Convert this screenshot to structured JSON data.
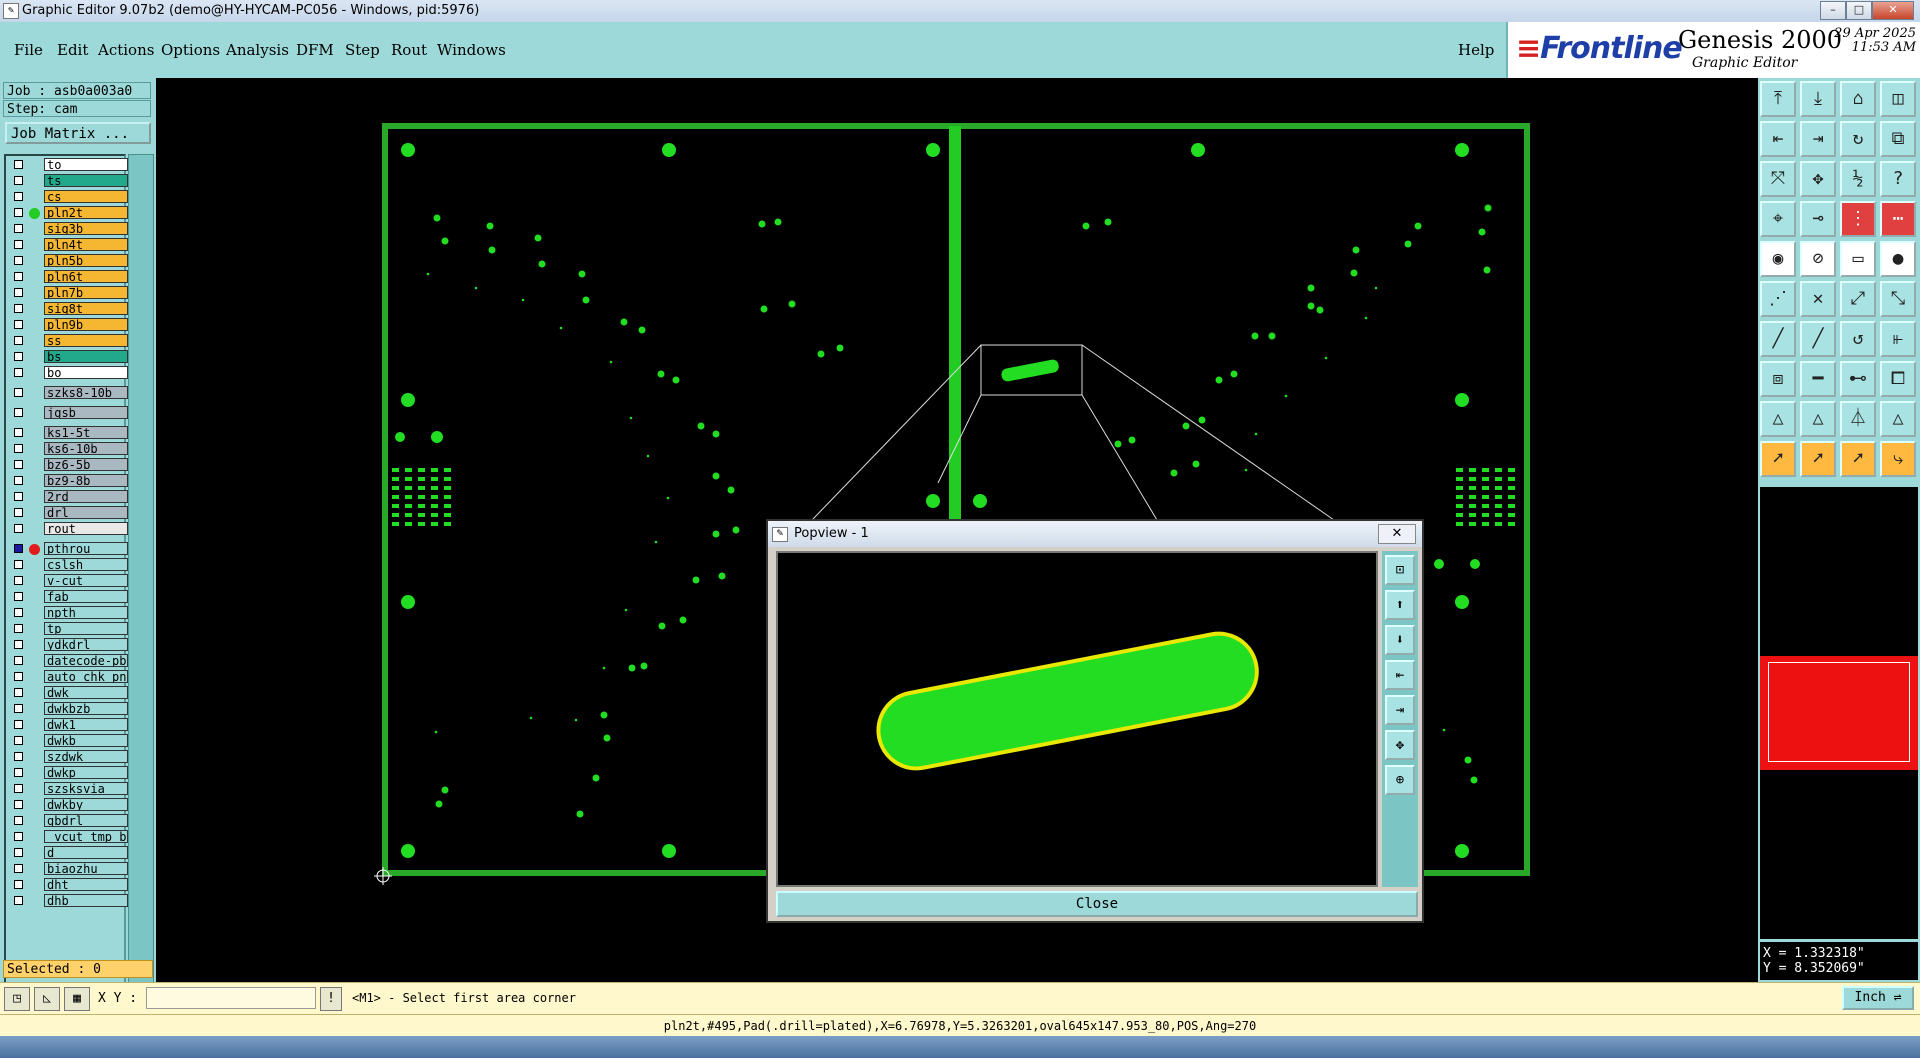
{
  "window": {
    "title": "Graphic Editor 9.07b2 (demo@HY-HYCAM-PC056 - Windows, pid:5976)",
    "min_label": "–",
    "max_label": "□",
    "close_label": "✕"
  },
  "menu": {
    "items": [
      "File",
      "Edit",
      "Actions",
      "Options",
      "Analysis",
      "DFM",
      "Step",
      "Rout",
      "Windows"
    ],
    "help": "Help"
  },
  "logo": {
    "brand_prefix": "≡",
    "brand": "Frontline",
    "product": "Genesis 2000",
    "subtitle": "Graphic Editor",
    "date": "29 Apr 2025",
    "time": "11:53 AM"
  },
  "job": {
    "job_line": "Job : asb0a003a0",
    "step_line": "Step: cam",
    "matrix_button": "Job Matrix ..."
  },
  "layers": [
    {
      "name": "to",
      "color": "#ffffff"
    },
    {
      "name": "ts",
      "color": "#22a88a"
    },
    {
      "name": "cs",
      "color": "#f5b731"
    },
    {
      "name": "pln2t",
      "color": "#f5b731",
      "active": true
    },
    {
      "name": "sig3b",
      "color": "#f5b731"
    },
    {
      "name": "pln4t",
      "color": "#f5b731"
    },
    {
      "name": "pln5b",
      "color": "#f5b731"
    },
    {
      "name": "pln6t",
      "color": "#f5b731"
    },
    {
      "name": "pln7b",
      "color": "#f5b731"
    },
    {
      "name": "sig8t",
      "color": "#f5b731"
    },
    {
      "name": "pln9b",
      "color": "#f5b731"
    },
    {
      "name": "ss",
      "color": "#f5b731"
    },
    {
      "name": "bs",
      "color": "#22a88a"
    },
    {
      "name": "bo",
      "color": "#ffffff"
    },
    {
      "name": "szks8-10b",
      "color": "#aab8c2",
      "gap": true
    },
    {
      "name": "jgsb",
      "color": "#aab8c2",
      "gap": true
    },
    {
      "name": "ks1-5t",
      "color": "#aab8c2",
      "gap": true
    },
    {
      "name": "ks6-10b",
      "color": "#aab8c2"
    },
    {
      "name": "bz6-5b",
      "color": "#aab8c2"
    },
    {
      "name": "bz9-8b",
      "color": "#aab8c2"
    },
    {
      "name": "2rd",
      "color": "#aab8c2"
    },
    {
      "name": "drl",
      "color": "#aab8c2"
    },
    {
      "name": "rout",
      "color": "#e8e8e8"
    },
    {
      "name": "pthrou",
      "color": "#9dd9d9",
      "gap": true,
      "checked": true,
      "red": true
    },
    {
      "name": "cslsh",
      "color": "#9dd9d9"
    },
    {
      "name": "v-cut",
      "color": "#9dd9d9"
    },
    {
      "name": "fab",
      "color": "#9dd9d9"
    },
    {
      "name": "npth",
      "color": "#9dd9d9"
    },
    {
      "name": "tp",
      "color": "#9dd9d9"
    },
    {
      "name": "ydkdrl",
      "color": "#9dd9d9"
    },
    {
      "name": "datecode-pbe",
      "color": "#9dd9d9"
    },
    {
      "name": "auto_chk_pn:",
      "color": "#9dd9d9"
    },
    {
      "name": "dwk",
      "color": "#9dd9d9"
    },
    {
      "name": "dwkbzb",
      "color": "#9dd9d9"
    },
    {
      "name": "dwk1",
      "color": "#9dd9d9"
    },
    {
      "name": "dwkb",
      "color": "#9dd9d9"
    },
    {
      "name": "szdwk",
      "color": "#9dd9d9"
    },
    {
      "name": "dwkp",
      "color": "#9dd9d9"
    },
    {
      "name": "szsksvia",
      "color": "#9dd9d9"
    },
    {
      "name": "dwkby",
      "color": "#9dd9d9"
    },
    {
      "name": "gbdrl",
      "color": "#9dd9d9"
    },
    {
      "name": "_vcut_tmp_ba",
      "color": "#9dd9d9"
    },
    {
      "name": "d",
      "color": "#9dd9d9"
    },
    {
      "name": "biaozhu",
      "color": "#9dd9d9"
    },
    {
      "name": "dht",
      "color": "#9dd9d9"
    },
    {
      "name": "dhb",
      "color": "#9dd9d9"
    }
  ],
  "selected": "Selected : 0",
  "coords": {
    "x": "X = 1.332318\"",
    "y": "Y = 8.352069\""
  },
  "cmd": {
    "xy_label": "X Y :",
    "xy_value": "",
    "prompt": "<M1> - Select first area corner",
    "unit": "Inch ⇌"
  },
  "status": "pln2t,#495,Pad(.drill=plated),X=6.76978,Y=5.3263201,oval645x147.953_80,POS,Ang=270",
  "popview": {
    "title": "Popview - 1",
    "close_x": "✕",
    "close_button": "Close"
  },
  "colors": {
    "feature": "#22dd22",
    "outline": "#2aa82a",
    "highlight": "#e8e800",
    "panel": "#9dd9d9"
  },
  "toolbar_icons": [
    "zoom-home-icon",
    "zoom-in-icon",
    "home-icon",
    "window-icon",
    "pan-left-icon",
    "pan-right-icon",
    "redraw-icon",
    "snap-icon",
    "fit-icon",
    "center-icon",
    "scale-icon",
    "help-icon",
    "filter-icon",
    "measure-icon",
    "dfm-icon",
    "graph-icon",
    "feature-icon",
    "netlist-icon",
    "ruler-icon",
    "dot-icon",
    "add-pad-icon",
    "delete-icon",
    "connect-icon",
    "split-icon",
    "line-icon",
    "arc-icon",
    "rotate-icon",
    "align-icon",
    "copy-icon",
    "minus-icon",
    "measure2-icon",
    "group-icon",
    "triangle-icon",
    "triangle2-icon",
    "triangle3-icon",
    "triangle4-icon",
    "select-icon",
    "select2-icon",
    "select3-icon",
    "route-icon"
  ]
}
